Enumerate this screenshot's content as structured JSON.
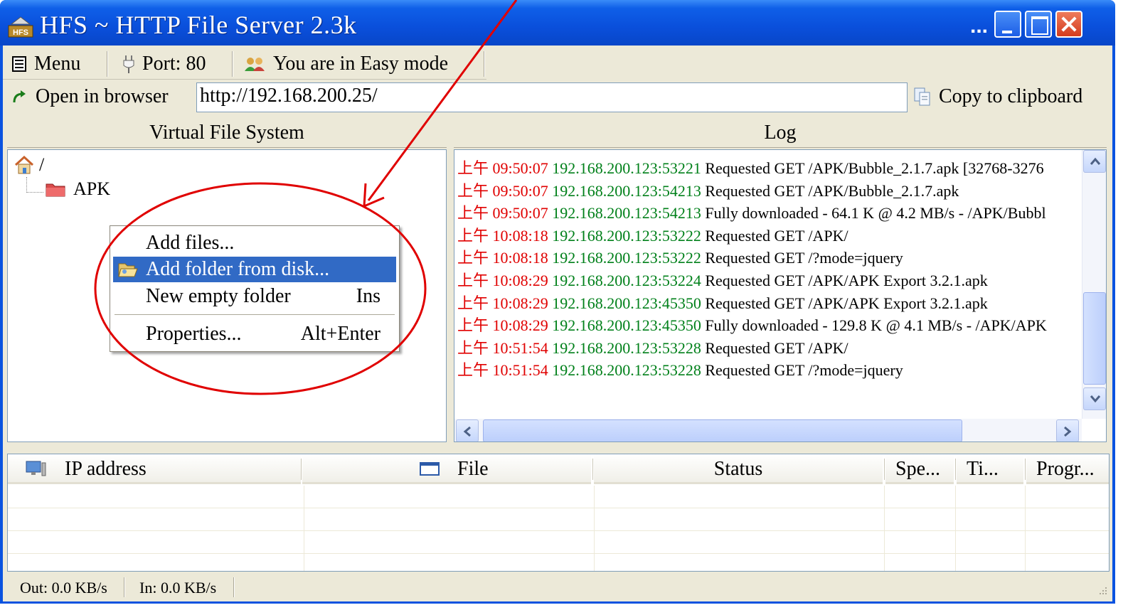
{
  "window": {
    "title": "HFS ~ HTTP File Server 2.3k",
    "title_dots": "..."
  },
  "toolbar": {
    "menu_label": "Menu",
    "port_label": "Port: 80",
    "mode_label": "You are in Easy mode",
    "open_browser_label": "Open in browser",
    "url_value": "http://192.168.200.25/",
    "copy_label": "Copy to clipboard"
  },
  "vfs": {
    "header": "Virtual File System",
    "root_label": "/",
    "folder_label": "APK"
  },
  "context_menu": {
    "items": [
      {
        "label": "Add files...",
        "shortcut": ""
      },
      {
        "label": "Add folder from disk...",
        "shortcut": ""
      },
      {
        "label": "New empty folder",
        "shortcut": "Ins"
      },
      {
        "label": "Properties...",
        "shortcut": "Alt+Enter"
      }
    ],
    "highlighted_index": 1
  },
  "log": {
    "header": "Log",
    "entries": [
      {
        "time": "上午 09:50:07",
        "ip": "192.168.200.123:53221",
        "msg": "Requested GET /APK/Bubble_2.1.7.apk  [32768-3276"
      },
      {
        "time": "上午 09:50:07",
        "ip": "192.168.200.123:54213",
        "msg": "Requested GET /APK/Bubble_2.1.7.apk"
      },
      {
        "time": "上午 09:50:07",
        "ip": "192.168.200.123:54213",
        "msg": "Fully downloaded - 64.1 K @ 4.2 MB/s - /APK/Bubbl"
      },
      {
        "time": "上午 10:08:18",
        "ip": "192.168.200.123:53222",
        "msg": "Requested GET /APK/"
      },
      {
        "time": "上午 10:08:18",
        "ip": "192.168.200.123:53222",
        "msg": "Requested GET /?mode=jquery"
      },
      {
        "time": "上午 10:08:29",
        "ip": "192.168.200.123:53224",
        "msg": "Requested GET /APK/APK Export 3.2.1.apk"
      },
      {
        "time": "上午 10:08:29",
        "ip": "192.168.200.123:45350",
        "msg": "Requested GET /APK/APK Export 3.2.1.apk"
      },
      {
        "time": "上午 10:08:29",
        "ip": "192.168.200.123:45350",
        "msg": "Fully downloaded - 129.8 K @ 4.1 MB/s - /APK/APK"
      },
      {
        "time": "上午 10:51:54",
        "ip": "192.168.200.123:53228",
        "msg": "Requested GET /APK/"
      },
      {
        "time": "上午 10:51:54",
        "ip": "192.168.200.123:53228",
        "msg": "Requested GET /?mode=jquery"
      }
    ]
  },
  "connections": {
    "columns": [
      "IP address",
      "File",
      "Status",
      "Spe...",
      "Ti...",
      "Progr..."
    ]
  },
  "statusbar": {
    "out": "Out: 0.0 KB/s",
    "in": "In: 0.0 KB/s"
  },
  "colors": {
    "log_time": "#e00000",
    "log_ip": "#00801a",
    "highlight": "#316ac5",
    "annotation": "#e00000"
  }
}
